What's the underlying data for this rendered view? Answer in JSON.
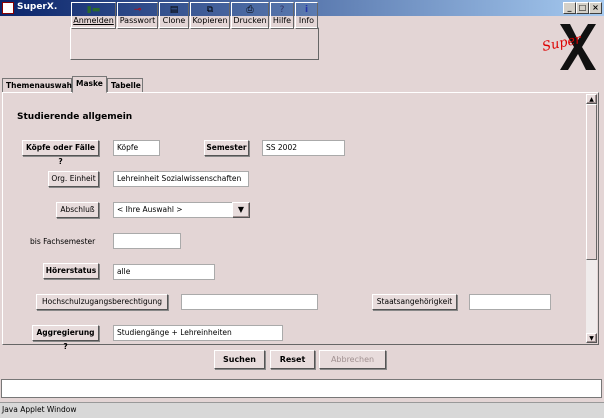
{
  "window": {
    "title": "SuperX."
  },
  "toolbar": {
    "buttons": [
      {
        "label": "Anmelden",
        "icon": "login-icon"
      },
      {
        "label": "Passwort",
        "icon": "key-icon"
      },
      {
        "label": "Clone",
        "icon": "clone-icon"
      },
      {
        "label": "Kopieren",
        "icon": "copy-icon"
      },
      {
        "label": "Drucken",
        "icon": "printer-icon"
      },
      {
        "label": "Hilfe",
        "icon": "help-icon"
      },
      {
        "label": "Info",
        "icon": "info-icon"
      }
    ]
  },
  "logo": {
    "text": "Super"
  },
  "tabs": [
    {
      "label": "Themenauswahl"
    },
    {
      "label": "Maske"
    },
    {
      "label": "Tabelle"
    }
  ],
  "form": {
    "heading": "Studierende allgemein",
    "koepfe_label": "Köpfe oder Fälle ?",
    "koepfe_value": "Köpfe",
    "semester_label": "Semester",
    "semester_value": "SS 2002",
    "org_label": "Org. Einheit",
    "org_value": "Lehreinheit Sozialwissenschaften",
    "abschluss_label": "Abschluß",
    "abschluss_value": "< Ihre Auswahl >",
    "fachsemester_label": "bis Fachsemester",
    "fachsemester_value": "",
    "hoererstatus_label": "Hörerstatus",
    "hoererstatus_value": "alle",
    "hzb_label": "Hochschulzugangsberechtigung",
    "hzb_value": "",
    "staat_label": "Staatsangehörigkeit",
    "staat_value": "",
    "aggregierung_label": "Aggregierung ?",
    "aggregierung_value": "Studiengänge + Lehreinheiten"
  },
  "actions": {
    "search": "Suchen",
    "reset": "Reset",
    "cancel": "Abbrechen"
  },
  "status": {
    "footer": "Java Applet Window"
  }
}
